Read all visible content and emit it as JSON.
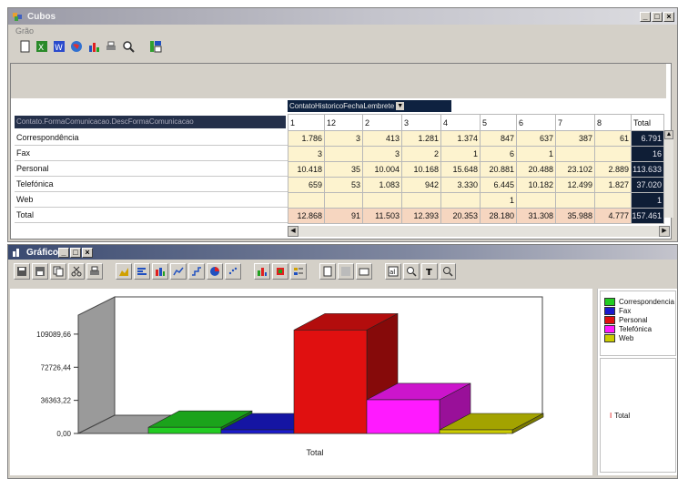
{
  "window_top": {
    "title": "Cubos",
    "menu": "Grão"
  },
  "pivot": {
    "column_field": "ContatoHistoricoFechaLembrete",
    "row_field": "Contato.FormaComunicacao.DescFormaComunicacao",
    "columns": [
      "1",
      "12",
      "2",
      "3",
      "4",
      "5",
      "6",
      "7",
      "8",
      "Total"
    ],
    "rows": [
      {
        "label": "Correspondência",
        "values": [
          "1.786",
          "3",
          "413",
          "1.281",
          "1.374",
          "847",
          "637",
          "387",
          "61",
          "6.791"
        ]
      },
      {
        "label": "Fax",
        "values": [
          "3",
          "",
          "3",
          "2",
          "1",
          "6",
          "1",
          "",
          "",
          "16"
        ]
      },
      {
        "label": "Personal",
        "values": [
          "10.418",
          "35",
          "10.004",
          "10.168",
          "15.648",
          "20.881",
          "20.488",
          "23.102",
          "2.889",
          "113.633"
        ]
      },
      {
        "label": "Telefónica",
        "values": [
          "659",
          "53",
          "1.083",
          "942",
          "3.330",
          "6.445",
          "10.182",
          "12.499",
          "1.827",
          "37.020"
        ]
      },
      {
        "label": "Web",
        "values": [
          "",
          "",
          "",
          "",
          "",
          "1",
          "",
          "",
          "",
          "1"
        ]
      },
      {
        "label": "Total",
        "values": [
          "12.868",
          "91",
          "11.503",
          "12.393",
          "20.353",
          "28.180",
          "31.308",
          "35.988",
          "4.777",
          "157.461"
        ]
      }
    ]
  },
  "window_bottom": {
    "title": "Gráfico"
  },
  "chart_data": {
    "type": "bar",
    "categories": [
      "Total"
    ],
    "series": [
      {
        "name": "Correspondencia",
        "values": [
          6791
        ],
        "color": "#22cc22"
      },
      {
        "name": "Fax",
        "values": [
          16
        ],
        "color": "#1a1acc"
      },
      {
        "name": "Personal",
        "values": [
          113633
        ],
        "color": "#e01010"
      },
      {
        "name": "Telefónica",
        "values": [
          37020
        ],
        "color": "#ff1aff"
      },
      {
        "name": "Web",
        "values": [
          1
        ],
        "color": "#cccc00"
      }
    ],
    "yticks": [
      "0,00",
      "36363,22",
      "72726,44",
      "109089,66"
    ],
    "xlabel": "Total",
    "ylim": [
      0,
      130000
    ],
    "legend_placement": "right",
    "legend_secondary": "Total"
  }
}
